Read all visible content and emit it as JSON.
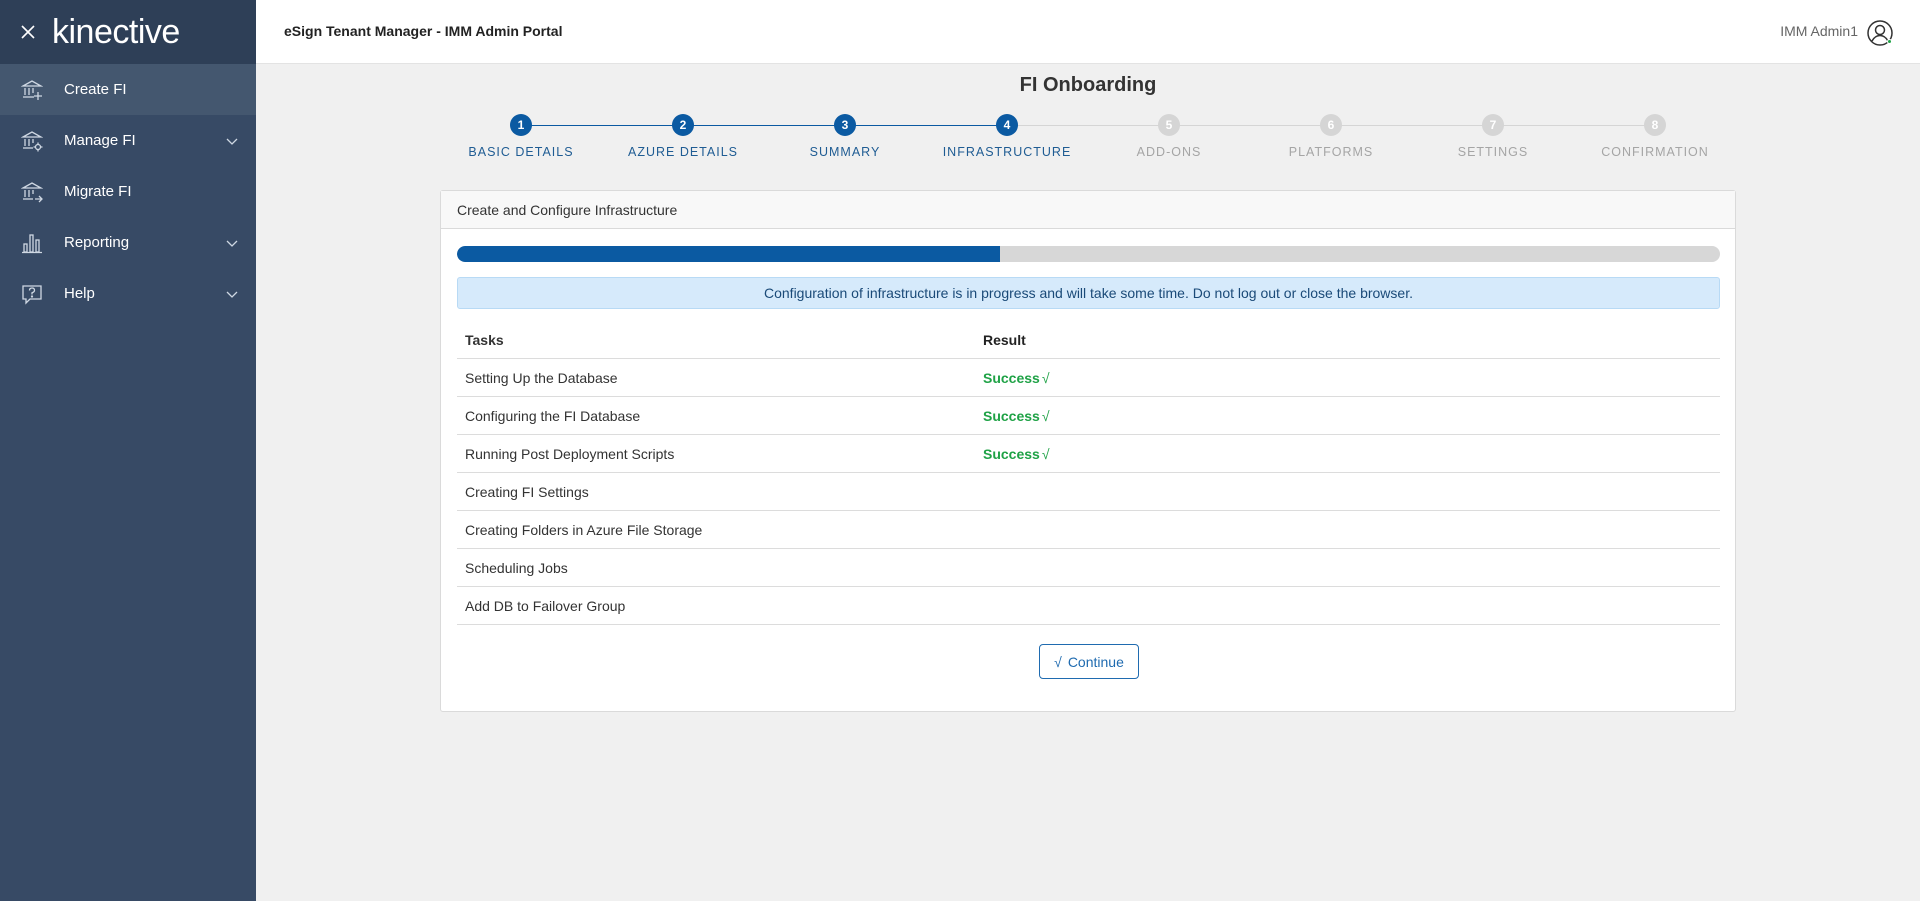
{
  "sidebar": {
    "logo": "kinective",
    "items": [
      {
        "label": "Create FI",
        "icon": "bank-add-icon",
        "active": true,
        "expandable": false
      },
      {
        "label": "Manage FI",
        "icon": "bank-gear-icon",
        "active": false,
        "expandable": true
      },
      {
        "label": "Migrate FI",
        "icon": "bank-arrow-icon",
        "active": false,
        "expandable": false
      },
      {
        "label": "Reporting",
        "icon": "bar-chart-icon",
        "active": false,
        "expandable": true
      },
      {
        "label": "Help",
        "icon": "help-icon",
        "active": false,
        "expandable": true
      }
    ]
  },
  "topbar": {
    "title": "eSign Tenant Manager - IMM Admin Portal",
    "user": "IMM Admin1"
  },
  "page": {
    "title": "FI Onboarding"
  },
  "stepper": {
    "steps": [
      {
        "number": "1",
        "label": "BASIC DETAILS",
        "state": "done"
      },
      {
        "number": "2",
        "label": "AZURE DETAILS",
        "state": "done"
      },
      {
        "number": "3",
        "label": "SUMMARY",
        "state": "done"
      },
      {
        "number": "4",
        "label": "INFRASTRUCTURE",
        "state": "done"
      },
      {
        "number": "5",
        "label": "ADD-ONS",
        "state": "todo"
      },
      {
        "number": "6",
        "label": "PLATFORMS",
        "state": "todo"
      },
      {
        "number": "7",
        "label": "SETTINGS",
        "state": "todo"
      },
      {
        "number": "8",
        "label": "CONFIRMATION",
        "state": "todo"
      }
    ]
  },
  "card": {
    "title": "Create and Configure Infrastructure",
    "progress_percent": 43,
    "alert": "Configuration of infrastructure is in progress and will take some time. Do not log out or close the browser.",
    "table": {
      "headers": {
        "task": "Tasks",
        "result": "Result"
      },
      "rows": [
        {
          "task": "Setting Up the Database",
          "result": "Success"
        },
        {
          "task": "Configuring the FI Database",
          "result": "Success"
        },
        {
          "task": "Running Post Deployment Scripts",
          "result": "Success"
        },
        {
          "task": "Creating FI Settings",
          "result": ""
        },
        {
          "task": "Creating Folders in Azure File Storage",
          "result": ""
        },
        {
          "task": "Scheduling Jobs",
          "result": ""
        },
        {
          "task": "Add DB to Failover Group",
          "result": ""
        }
      ]
    },
    "continue_label": "Continue"
  },
  "colors": {
    "sidebar_bg": "#374a65",
    "primary": "#0b5aa2",
    "success": "#1fa246",
    "inactive_step": "#d5d5d5"
  }
}
